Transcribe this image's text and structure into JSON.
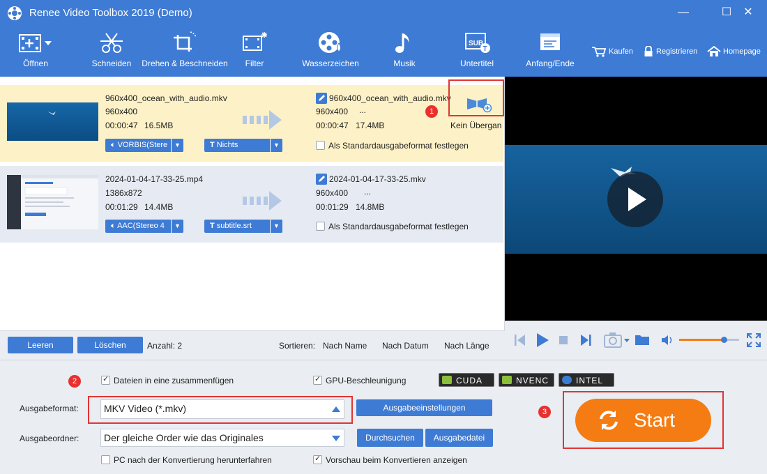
{
  "window": {
    "title": "Renee Video Toolbox 2019 (Demo)",
    "controls": [
      "—",
      "☐",
      "✕"
    ]
  },
  "toolbar": {
    "open": "Öffnen",
    "cut": "Schneiden",
    "rotate_crop": "Drehen & Beschneiden",
    "filter": "Filter",
    "watermark": "Wasserzeichen",
    "music": "Musik",
    "subtitle": "Untertitel",
    "start_end": "Anfang/Ende",
    "buy": "Kaufen",
    "register": "Registrieren",
    "homepage": "Homepage"
  },
  "files": [
    {
      "src_name": "960x400_ocean_with_audio.mkv",
      "src_res": "960x400",
      "src_duration": "00:00:47",
      "src_size": "16.5MB",
      "out_name": "960x400_ocean_with_audio.mkv",
      "out_res": "960x400",
      "out_more": "...",
      "out_duration": "00:00:47",
      "out_size": "17.4MB",
      "transition": "Kein Übergan",
      "audio_track": "VORBIS(Stere",
      "subtitle_track": "Nichts",
      "default_format_label": "Als Standardausgabeformat festlegen"
    },
    {
      "src_name": "2024-01-04-17-33-25.mp4",
      "src_res": "1386x872",
      "src_duration": "00:01:29",
      "src_size": "14.4MB",
      "out_name": "2024-01-04-17-33-25.mkv",
      "out_res": "960x400",
      "out_more": "...",
      "out_duration": "00:01:29",
      "out_size": "14.8MB",
      "audio_track": "AAC(Stereo 4",
      "subtitle_track": "subtitle.srt",
      "default_format_label": "Als Standardausgabeformat festlegen"
    }
  ],
  "list_footer": {
    "clear": "Leeren",
    "delete": "Löschen",
    "count_label": "Anzahl: 2",
    "sort_label": "Sortieren:",
    "sort_name": "Nach Name",
    "sort_date": "Nach Datum",
    "sort_length": "Nach Länge"
  },
  "settings": {
    "merge_label": "Dateien in eine zusammenfügen",
    "gpu_label": "GPU-Beschleunigung",
    "gpu_badges": [
      "CUDA",
      "NVENC",
      "INTEL"
    ],
    "format_label": "Ausgabeformat:",
    "format_value": "MKV Video (*.mkv)",
    "output_settings_btn": "Ausgabeeinstellungen",
    "folder_label": "Ausgabeordner:",
    "folder_value": "Der gleiche Order wie das Originales",
    "browse_btn": "Durchsuchen",
    "output_file_btn": "Ausgabedatei",
    "shutdown_label": "PC nach der Konvertierung herunterfahren",
    "preview_label": "Vorschau beim Konvertieren anzeigen",
    "start_btn": "Start"
  },
  "annotations": [
    "1",
    "2",
    "3"
  ],
  "colors": {
    "accent": "#3e7bd4",
    "row_selected": "#fdf1c7",
    "start": "#f57c13",
    "marker": "#e8312f"
  }
}
